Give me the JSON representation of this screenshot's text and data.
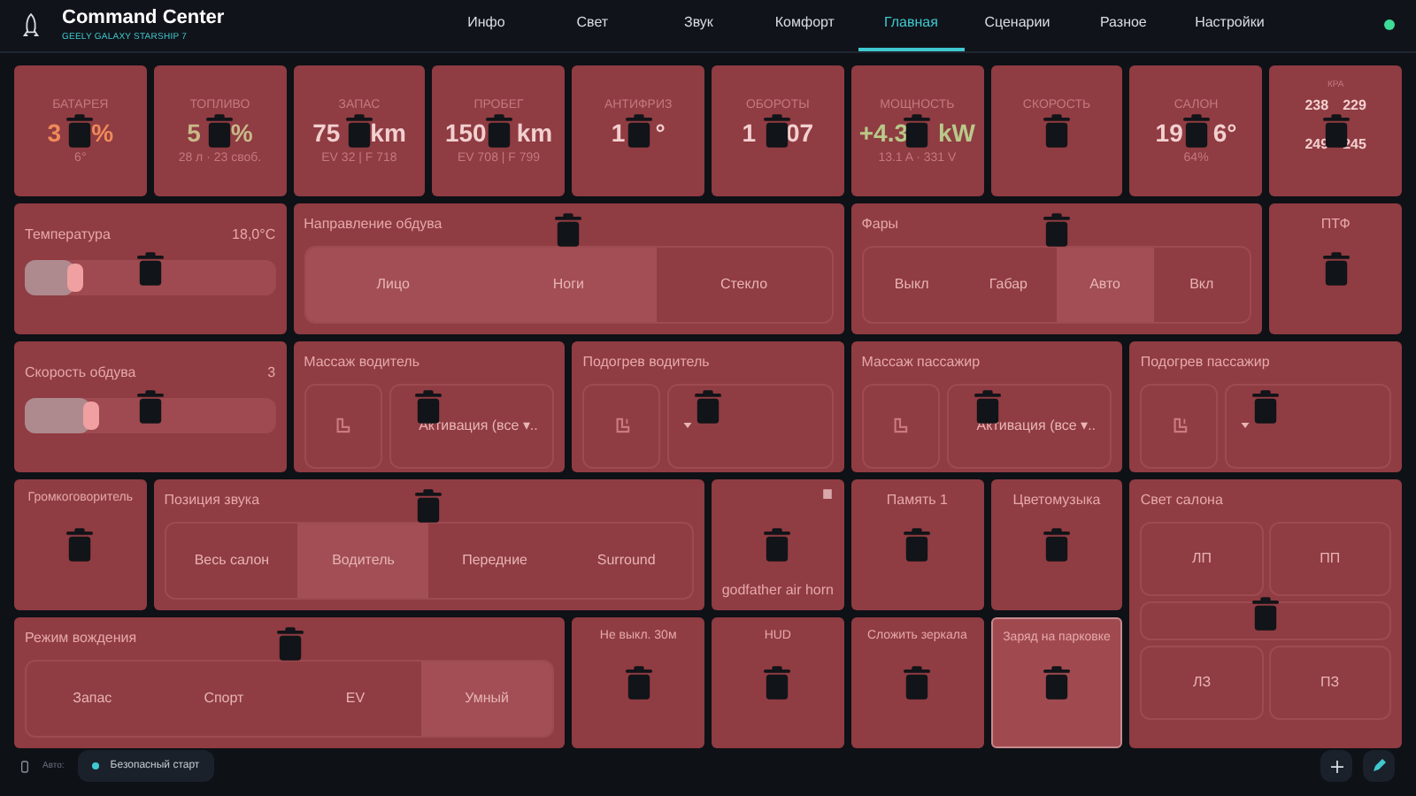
{
  "header": {
    "title": "Command Center",
    "subtitle": "GEELY GALAXY STARSHIP 7",
    "online": true,
    "nav": [
      {
        "label": "Инфо",
        "selected": false
      },
      {
        "label": "Свет",
        "selected": false
      },
      {
        "label": "Звук",
        "selected": false
      },
      {
        "label": "Комфорт",
        "selected": false
      },
      {
        "label": "Главная",
        "selected": true
      },
      {
        "label": "Сценарии",
        "selected": false
      },
      {
        "label": "Разное",
        "selected": false
      },
      {
        "label": "Настройки",
        "selected": false
      }
    ]
  },
  "stats": [
    {
      "label": "БАТАРЕЯ",
      "value": [
        "3",
        "%"
      ],
      "sub": "6°",
      "color": "#f08a5a"
    },
    {
      "label": "ТОПЛИВО",
      "value": [
        "5",
        "%"
      ],
      "sub": "28 л · 23 своб.",
      "color": "#c9b98a"
    },
    {
      "label": "ЗАПАС",
      "value": [
        "75",
        "km"
      ],
      "sub": "EV 32 | F 718"
    },
    {
      "label": "ПРОБЕГ",
      "value": [
        "150",
        "km"
      ],
      "sub": "EV 708 | F 799"
    },
    {
      "label": "АНТИФРИЗ",
      "value": [
        "1",
        "°"
      ]
    },
    {
      "label": "ОБОРОТЫ",
      "value": [
        "1",
        "07"
      ]
    },
    {
      "label": "МОЩНОСТЬ",
      "value": [
        "+4.3",
        "kW"
      ],
      "sub": "13.1 A · 331 V",
      "color": "#b8c98a"
    },
    {
      "label": "СКОРОСТЬ"
    },
    {
      "label": "САЛОН",
      "value": [
        "19",
        "6°"
      ],
      "sub": "64%"
    }
  ],
  "tires": {
    "label": "КРА",
    "values": [
      "238",
      "229",
      "249",
      "245"
    ]
  },
  "temperature": {
    "label": "Температура",
    "reading": "18,0°C",
    "level": 0.2
  },
  "airflow": {
    "label": "Направление обдува",
    "options": [
      {
        "label": "Лицо",
        "selected": true
      },
      {
        "label": "Ноги",
        "selected": true
      },
      {
        "label": "Стекло",
        "selected": false
      }
    ]
  },
  "headlights": {
    "label": "Фары",
    "options": [
      {
        "label": "Выкл",
        "selected": false
      },
      {
        "label": "Габар",
        "selected": false
      },
      {
        "label": "Авто",
        "selected": true
      },
      {
        "label": "Вкл",
        "selected": false
      }
    ]
  },
  "fog": {
    "label": "ПТФ"
  },
  "fan": {
    "label": "Скорость обдува",
    "reading": "3",
    "level": 0.26
  },
  "seats": [
    {
      "label": "Массаж водитель",
      "kind": "massage",
      "value": "Активация (все ▾.."
    },
    {
      "label": "Подогрев водитель",
      "kind": "heat"
    },
    {
      "label": "Массаж пассажир",
      "kind": "massage",
      "value": "Активация (все ▾.."
    },
    {
      "label": "Подогрев пассажир",
      "kind": "heat"
    }
  ],
  "speaker": {
    "label": "Громкоговоритель"
  },
  "sound_position": {
    "label": "Позиция звука",
    "options": [
      {
        "label": "Весь салон",
        "selected": false
      },
      {
        "label": "Водитель",
        "selected": true
      },
      {
        "label": "Передние",
        "selected": false
      },
      {
        "label": "Surround",
        "selected": false
      }
    ]
  },
  "horn": {
    "label": "godfather air horn"
  },
  "memory": {
    "label": "Память 1"
  },
  "color_music": {
    "label": "Цветомузыка"
  },
  "cabin_light": {
    "label": "Свет салона",
    "zones": [
      "ЛП",
      "ПП",
      "ЛЗ",
      "ПЗ"
    ]
  },
  "drive_mode": {
    "label": "Режим вождения",
    "options": [
      {
        "label": "Запас",
        "selected": false
      },
      {
        "label": "Спорт",
        "selected": false
      },
      {
        "label": "EV",
        "selected": false
      },
      {
        "label": "Умный",
        "selected": true
      }
    ]
  },
  "small_tiles": [
    {
      "label": "Не выкл. 30м",
      "selected": false
    },
    {
      "label": "HUD",
      "selected": false
    },
    {
      "label": "Сложить зеркала",
      "selected": false
    },
    {
      "label": "Заряд на парковке",
      "selected": true
    }
  ],
  "footer": {
    "label": "Авто:",
    "chip": "Безопасный старт"
  }
}
